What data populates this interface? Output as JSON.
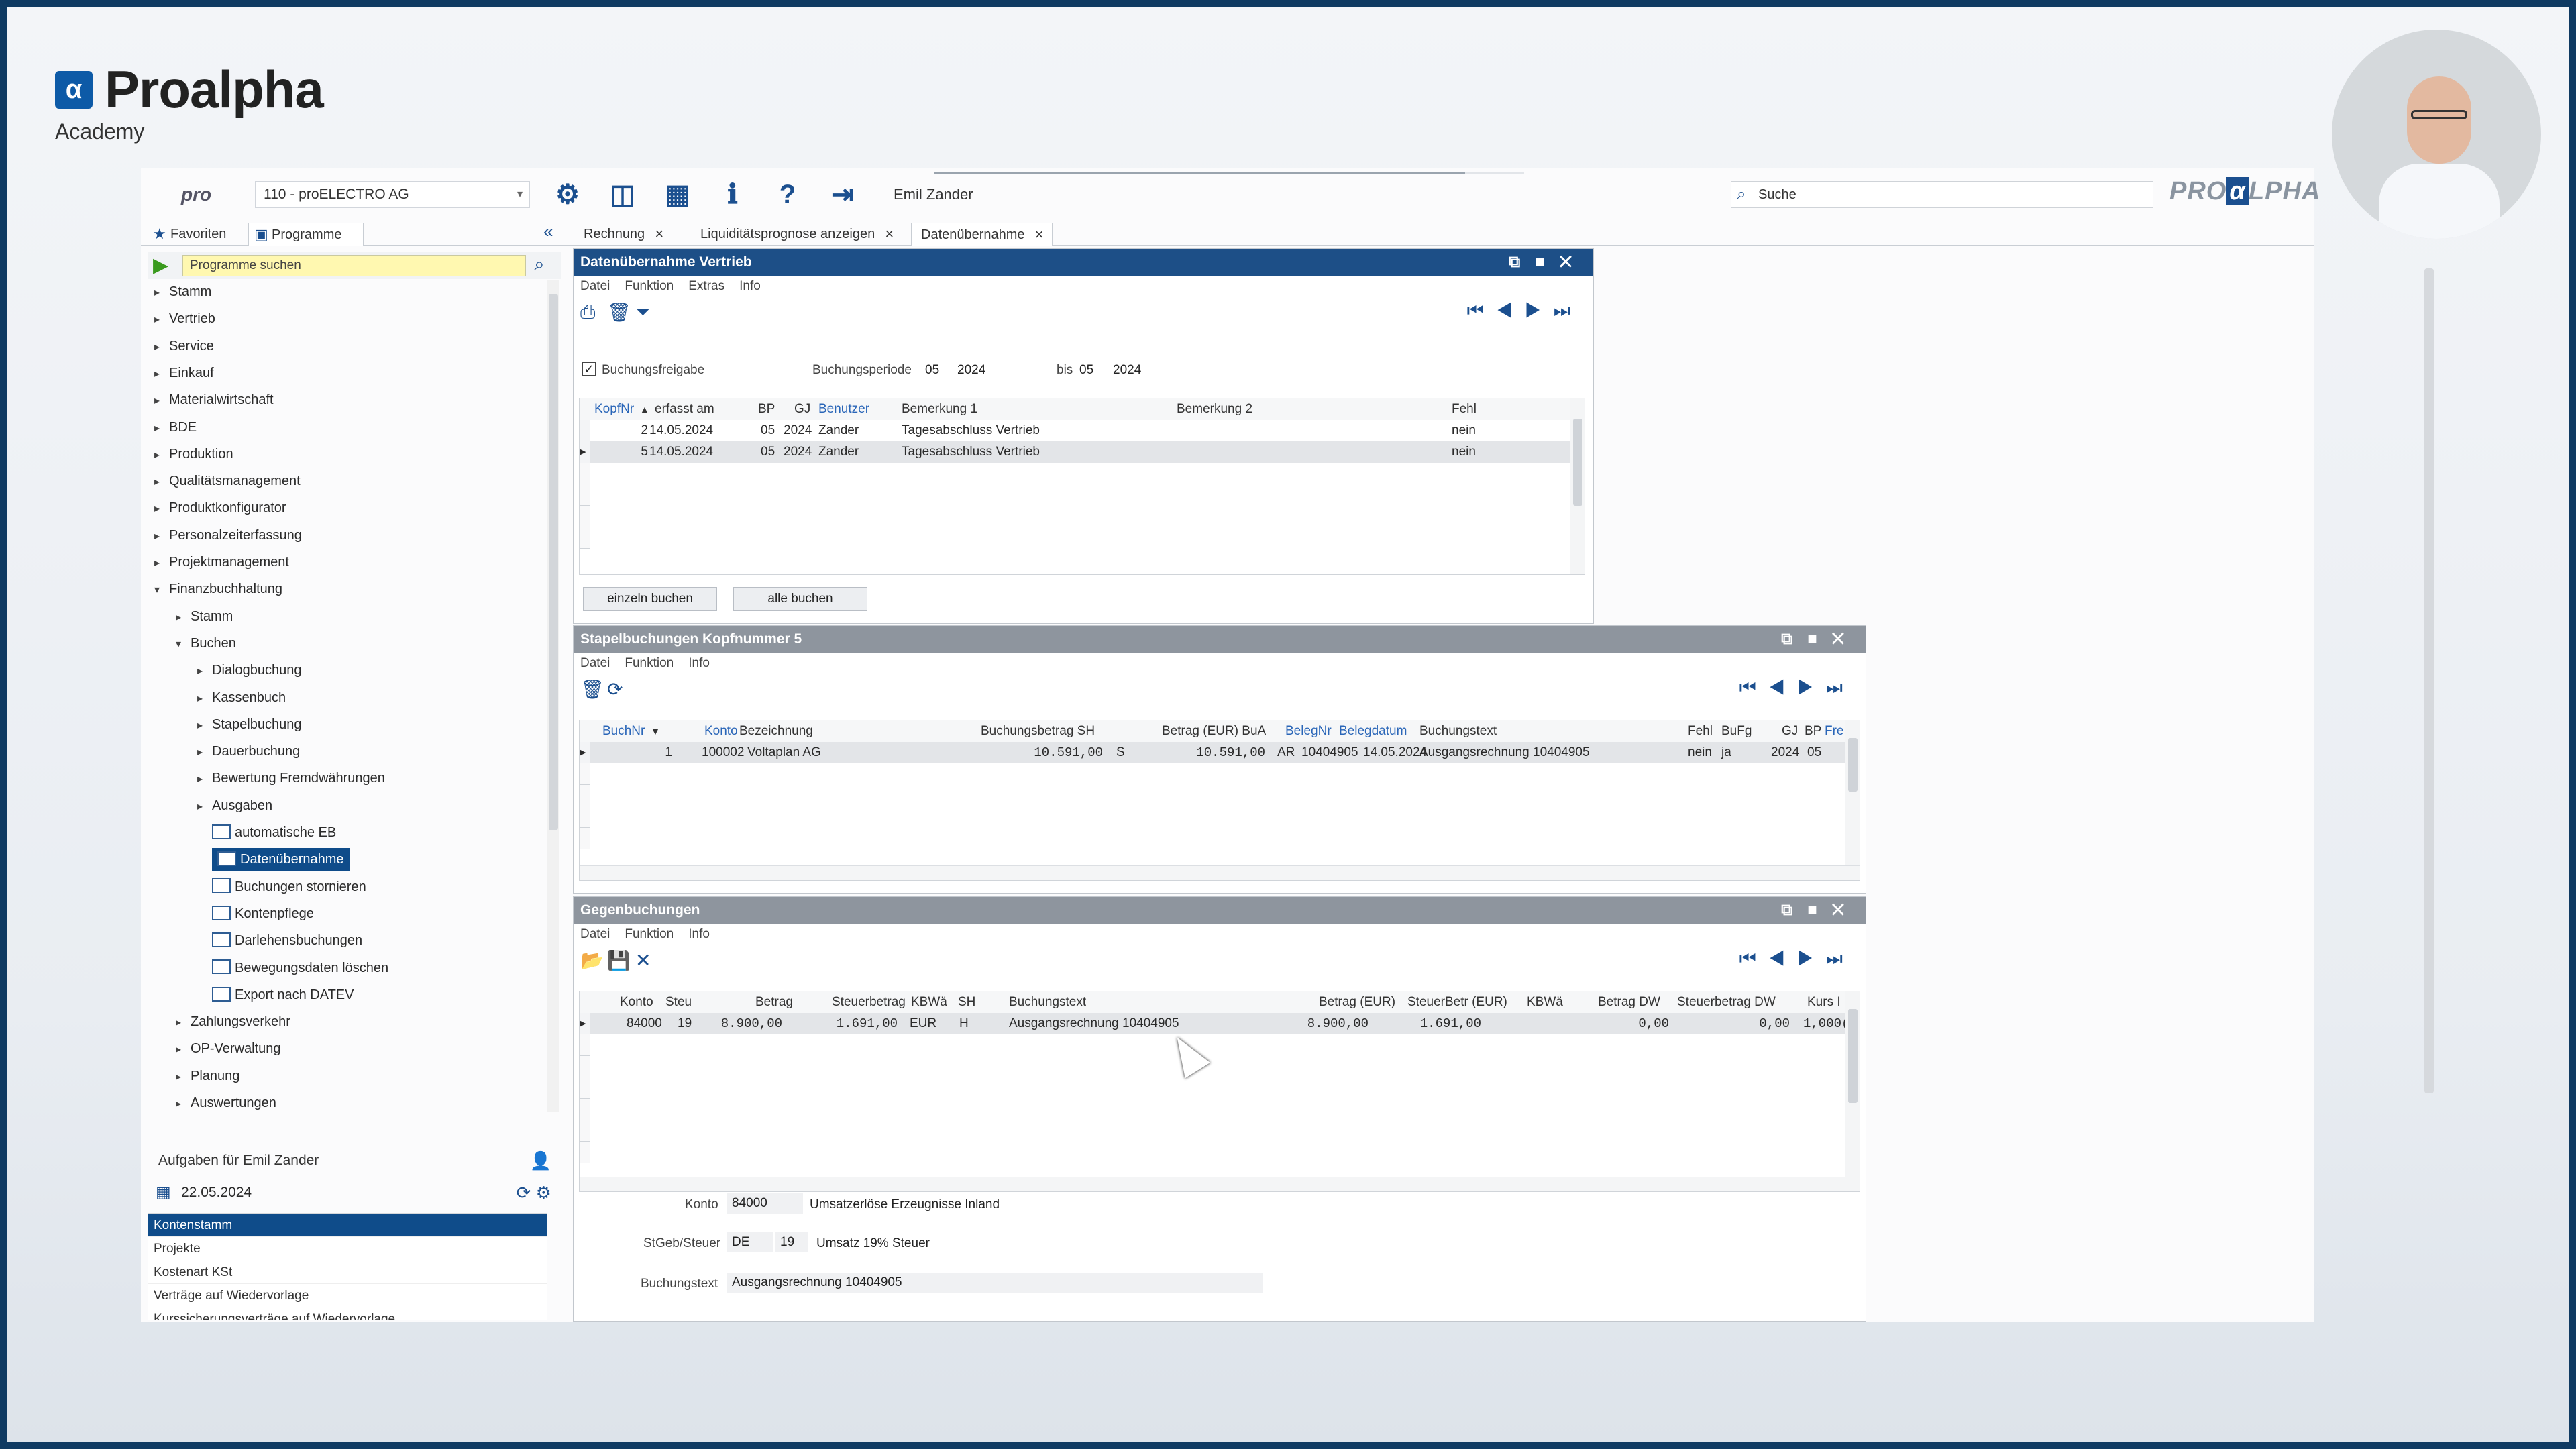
{
  "brand": {
    "name": "Proalpha",
    "sub": "Academy"
  },
  "topbar": {
    "company": "110 - proELECTRO AG",
    "user": "Emil Zander",
    "search_placeholder": "Suche",
    "pro_logo": "pro",
    "logo_text": "PRO",
    "logo_alpha": "α",
    "logo_tail": "LPHA",
    "progress_fraction": 0.9
  },
  "lefttabs": {
    "favoriten": "Favoriten",
    "programme": "Programme"
  },
  "doctabs": [
    "Rechnung",
    "Liquiditätsprognose anzeigen",
    "Datenübernahme"
  ],
  "sidebar": {
    "search_placeholder": "Programme suchen",
    "tree": [
      {
        "label": "Stamm",
        "level": 0,
        "type": "folder"
      },
      {
        "label": "Vertrieb",
        "level": 0,
        "type": "folder"
      },
      {
        "label": "Service",
        "level": 0,
        "type": "folder"
      },
      {
        "label": "Einkauf",
        "level": 0,
        "type": "folder"
      },
      {
        "label": "Materialwirtschaft",
        "level": 0,
        "type": "folder"
      },
      {
        "label": "BDE",
        "level": 0,
        "type": "folder"
      },
      {
        "label": "Produktion",
        "level": 0,
        "type": "folder"
      },
      {
        "label": "Qualitätsmanagement",
        "level": 0,
        "type": "folder"
      },
      {
        "label": "Produktkonfigurator",
        "level": 0,
        "type": "folder"
      },
      {
        "label": "Personalzeiterfassung",
        "level": 0,
        "type": "folder"
      },
      {
        "label": "Projektmanagement",
        "level": 0,
        "type": "folder"
      },
      {
        "label": "Finanzbuchhaltung",
        "level": 0,
        "type": "open"
      },
      {
        "label": "Stamm",
        "level": 1,
        "type": "folder"
      },
      {
        "label": "Buchen",
        "level": 1,
        "type": "open"
      },
      {
        "label": "Dialogbuchung",
        "level": 2,
        "type": "folder"
      },
      {
        "label": "Kassenbuch",
        "level": 2,
        "type": "folder"
      },
      {
        "label": "Stapelbuchung",
        "level": 2,
        "type": "folder"
      },
      {
        "label": "Dauerbuchung",
        "level": 2,
        "type": "folder"
      },
      {
        "label": "Bewertung Fremdwährungen",
        "level": 2,
        "type": "folder"
      },
      {
        "label": "Ausgaben",
        "level": 2,
        "type": "folder"
      },
      {
        "label": "automatische EB",
        "level": 3,
        "type": "program"
      },
      {
        "label": "Datenübernahme",
        "level": 3,
        "type": "program",
        "selected": true
      },
      {
        "label": "Buchungen stornieren",
        "level": 3,
        "type": "program"
      },
      {
        "label": "Kontenpflege",
        "level": 3,
        "type": "program"
      },
      {
        "label": "Darlehensbuchungen",
        "level": 3,
        "type": "program"
      },
      {
        "label": "Bewegungsdaten löschen",
        "level": 3,
        "type": "program"
      },
      {
        "label": "Export nach DATEV",
        "level": 3,
        "type": "program"
      },
      {
        "label": "Zahlungsverkehr",
        "level": 1,
        "type": "folder"
      },
      {
        "label": "OP-Verwaltung",
        "level": 1,
        "type": "folder"
      },
      {
        "label": "Planung",
        "level": 1,
        "type": "folder"
      },
      {
        "label": "Auswertungen",
        "level": 1,
        "type": "folder"
      }
    ],
    "tasks_title": "Aufgaben für Emil Zander",
    "tasks_date": "22.05.2024",
    "tasks": [
      "Kontenstamm",
      "Projekte",
      "Kostenart KSt",
      "Verträge auf Wiedervorlage",
      "Kurssicherungsverträge auf Wiedervorlage"
    ]
  },
  "panel1": {
    "title": "Datenübernahme  Vertrieb",
    "menu": [
      "Datei",
      "Funktion",
      "Extras",
      "Info"
    ],
    "buchungsfreigabe": "Buchungsfreigabe",
    "periode_label": "Buchungsperiode",
    "periode_from_p": "05",
    "periode_from_y": "2024",
    "bis_label": "bis",
    "periode_to_p": "05",
    "periode_to_y": "2024",
    "headers": {
      "kopfnr": "KopfNr",
      "erfasst": "erfasst am",
      "bp": "BP",
      "gj": "GJ",
      "benutzer": "Benutzer",
      "bem1": "Bemerkung 1",
      "bem2": "Bemerkung 2",
      "fehl": "Fehl"
    },
    "rows": [
      {
        "kopfnr": "2",
        "erfasst": "14.05.2024",
        "bp": "05",
        "gj": "2024",
        "benutzer": "Zander",
        "bem1": "Tagesabschluss Vertrieb",
        "bem2": "",
        "fehl": "nein"
      },
      {
        "kopfnr": "5",
        "erfasst": "14.05.2024",
        "bp": "05",
        "gj": "2024",
        "benutzer": "Zander",
        "bem1": "Tagesabschluss Vertrieb",
        "bem2": "",
        "fehl": "nein"
      }
    ],
    "btn_einzeln": "einzeln buchen",
    "btn_alle": "alle buchen"
  },
  "panel2": {
    "title": "Stapelbuchungen Kopfnummer 5",
    "menu": [
      "Datei",
      "Funktion",
      "Info"
    ],
    "headers": {
      "buchnr": "BuchNr",
      "konto": "Konto",
      "bez": "Bezeichnung",
      "betrag_sh": "Buchungsbetrag SH",
      "betrag_eur": "Betrag (EUR) BuA",
      "belegnr": "BelegNr",
      "belegdatum": "Belegdatum",
      "text": "Buchungstext",
      "fehl": "Fehl",
      "bufg": "BuFg",
      "gj": "GJ",
      "bp": "BP",
      "fre": "Fre"
    },
    "row": {
      "buchnr": "1",
      "konto": "100002",
      "bez": "Voltaplan AG",
      "betrag": "10.591,00",
      "sh": "S",
      "betrag_eur": "10.591,00",
      "bua": "AR",
      "belegnr": "10404905",
      "belegdatum": "14.05.2024",
      "text": "Ausgangsrechnung 10404905",
      "fehl": "nein",
      "bufg": "ja",
      "gj": "2024",
      "bp": "05"
    }
  },
  "panel3": {
    "title": "Gegenbuchungen",
    "menu": [
      "Datei",
      "Funktion",
      "Info"
    ],
    "headers": {
      "konto": "Konto",
      "steu": "Steu",
      "betrag": "Betrag",
      "steuerbetrag": "Steuerbetrag",
      "kbwa": "KBWä",
      "sh": "SH",
      "text": "Buchungstext",
      "betrag_eur": "Betrag (EUR)",
      "steuerbetr_eur": "SteuerBetr (EUR)",
      "kbwa2": "KBWä",
      "betrag_dw": "Betrag DW",
      "steuerbetrag_dw": "Steuerbetrag DW",
      "kurs": "Kurs I"
    },
    "row": {
      "konto": "84000",
      "steu": "19",
      "betrag": "8.900,00",
      "steuerbetrag": "1.691,00",
      "kbwa": "EUR",
      "sh": "H",
      "text": "Ausgangsrechnung 10404905",
      "betrag_eur": "8.900,00",
      "steuerbetr_eur": "1.691,00",
      "betrag_dw": "0,00",
      "steuerbetrag_dw": "0,00",
      "kurs": "1,000("
    },
    "detail": {
      "konto_label": "Konto",
      "konto": "84000",
      "konto_text": "Umsatzerlöse Erzeugnisse Inland",
      "steu_label": "StGeb/Steuer",
      "steu_land": "DE",
      "steu_code": "19",
      "steu_text": "Umsatz 19% Steuer",
      "text_label": "Buchungstext",
      "text": "Ausgangsrechnung 10404905"
    }
  }
}
